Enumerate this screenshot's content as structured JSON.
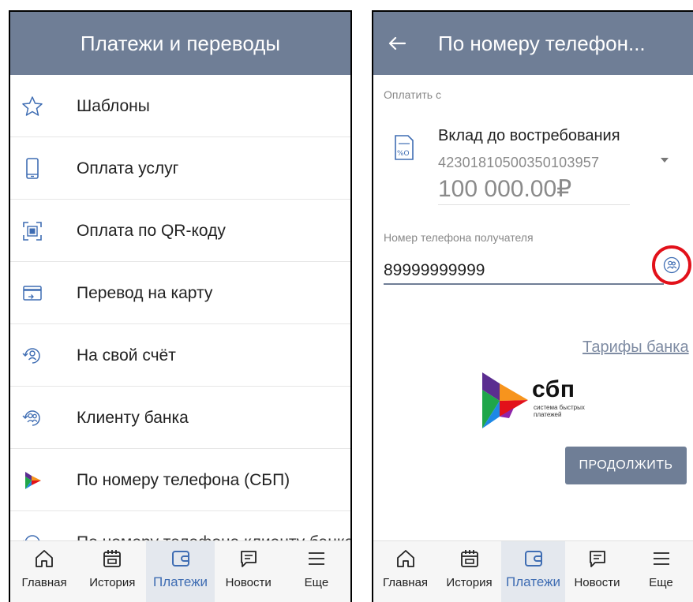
{
  "left_screen": {
    "header": {
      "title": "Платежи и переводы"
    },
    "menu": {
      "items": [
        {
          "label": "Шаблоны",
          "icon": "star-icon"
        },
        {
          "label": "Оплата услуг",
          "icon": "phone-icon"
        },
        {
          "label": "Оплата по QR-коду",
          "icon": "qr-scan-icon"
        },
        {
          "label": "Перевод на карту",
          "icon": "card-transfer-icon"
        },
        {
          "label": "На свой счёт",
          "icon": "own-account-icon"
        },
        {
          "label": "Клиенту банка",
          "icon": "bank-client-icon"
        },
        {
          "label": "По номеру телефона (СБП)",
          "icon": "sbp-icon"
        },
        {
          "label": "По номеру телефона клиенту банка",
          "icon": "bank-client-phone-icon"
        }
      ]
    }
  },
  "right_screen": {
    "header": {
      "title": "По номеру телефон..."
    },
    "pay_from_label": "Оплатить с",
    "account": {
      "name": "Вклад до востребования",
      "number": "42301810500350103957",
      "balance": "100 000.00₽"
    },
    "phone_label": "Номер телефона получателя",
    "phone_value": "89999999999",
    "tariffs_link": "Тарифы банка",
    "sbp": {
      "name": "сбп",
      "subtitle_line1": "система быстрых",
      "subtitle_line2": "платежей"
    },
    "continue_label": "ПРОДОЛЖИТЬ"
  },
  "bottom_nav": {
    "items": [
      {
        "label": "Главная",
        "icon": "home-icon"
      },
      {
        "label": "История",
        "icon": "calendar-icon"
      },
      {
        "label": "Платежи",
        "icon": "wallet-icon",
        "active": true
      },
      {
        "label": "Новости",
        "icon": "chat-icon"
      },
      {
        "label": "Еще",
        "icon": "menu-icon"
      }
    ]
  },
  "colors": {
    "header": "#6f7e96",
    "accent": "#3f6db3",
    "highlight_circle": "#e2111a",
    "sbp_orange": "#f7941d",
    "sbp_purple": "#5b2d90",
    "sbp_green": "#1fa64a",
    "sbp_blue": "#1e88e5"
  }
}
